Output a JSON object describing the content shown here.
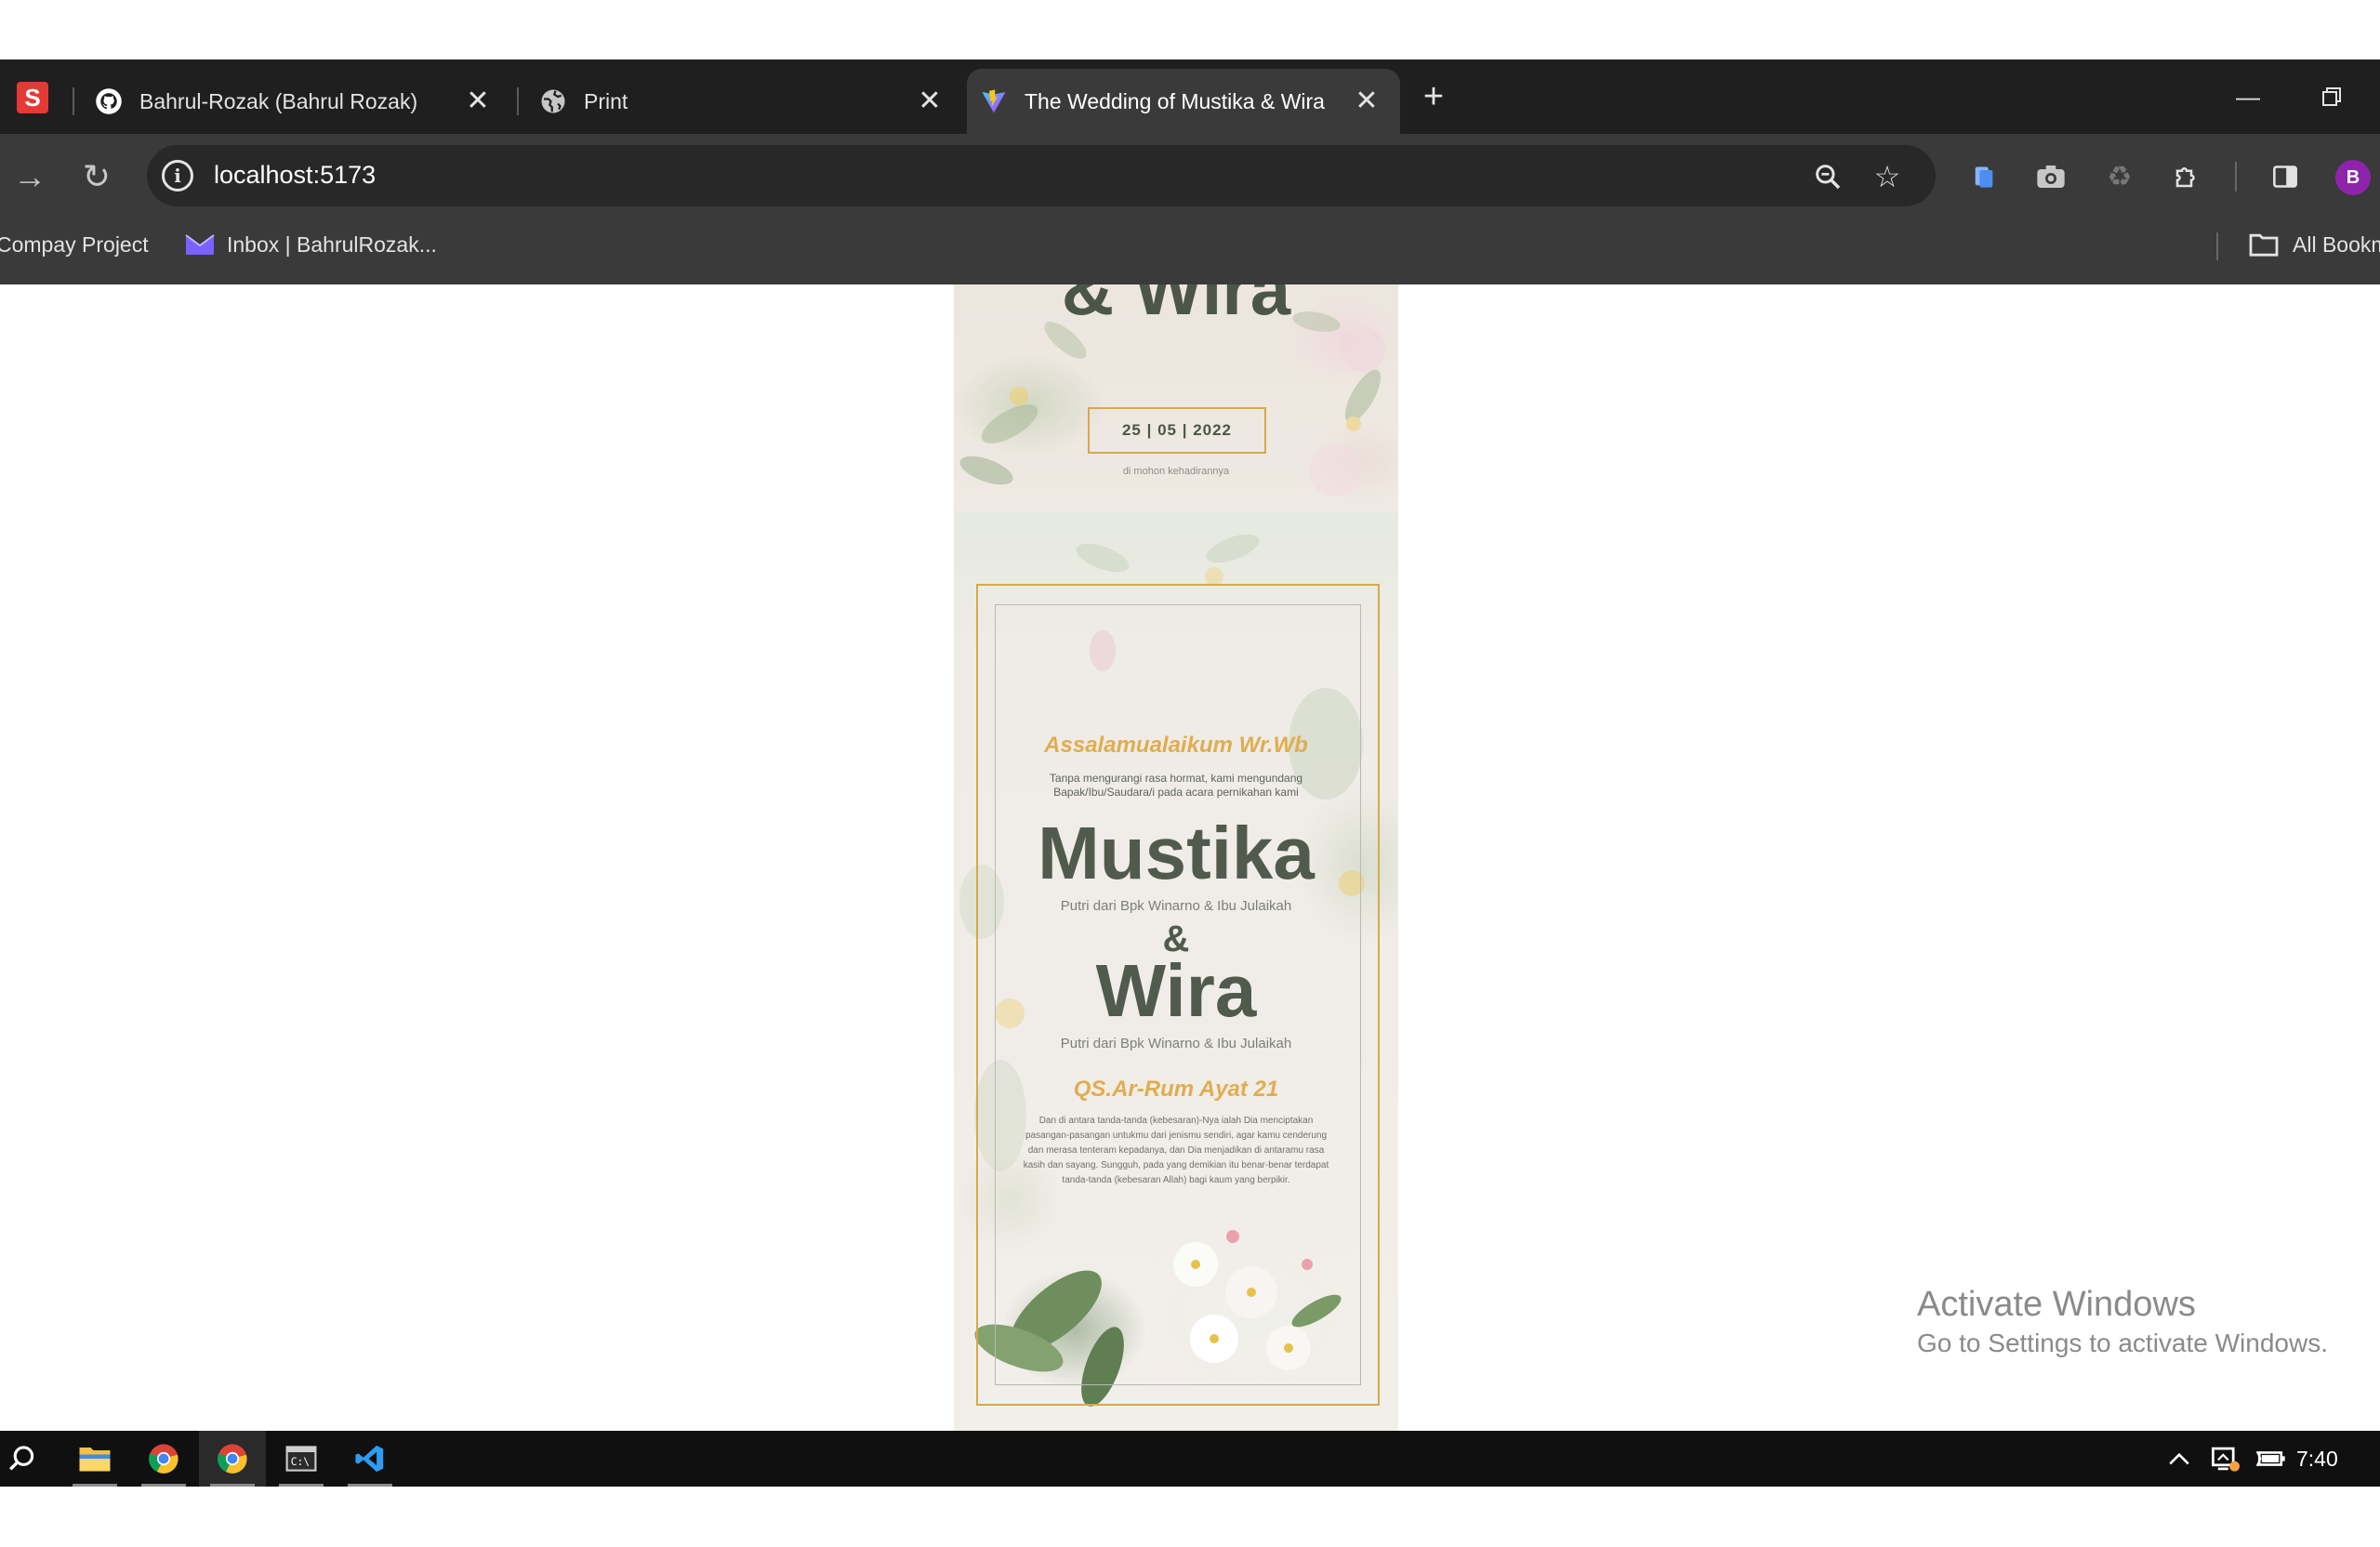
{
  "browser": {
    "tabs": [
      {
        "title": "Bahrul-Rozak (Bahrul Rozak)",
        "icon": "github-icon"
      },
      {
        "title": "Print",
        "icon": "globe-icon"
      },
      {
        "title": "The Wedding of Mustika & Wira",
        "icon": "vite-icon",
        "active": true
      }
    ],
    "pinned_icon": "S",
    "address": "localhost:5173",
    "profile_initial": "B",
    "bookmarks": [
      {
        "label": "Compay Project"
      },
      {
        "label": "Inbox | BahrulRozak..."
      }
    ],
    "all_bookmarks_label": "All Bookmarks"
  },
  "invitation": {
    "hero_name": "& Wira",
    "date": "25 | 05 | 2022",
    "hero_subtitle": "di mohon kehadirannya",
    "greeting": "Assalamualaikum Wr.Wb",
    "intro": "Tanpa mengurangi rasa hormat, kami mengundang Bapak/Ibu/Saudara/i pada acara pernikahan kami",
    "bride_name": "Mustika",
    "bride_parents": "Putri dari Bpk Winarno & Ibu Julaikah",
    "ampersand": "&",
    "groom_name": "Wira",
    "groom_parents": "Putri dari Bpk Winarno & Ibu Julaikah",
    "verse_title": "QS.Ar-Rum Ayat 21",
    "verse_text": "Dan di antara tanda-tanda (kebesaran)-Nya ialah Dia menciptakan pasangan-pasangan untukmu dari jenismu sendiri, agar kamu cenderung dan merasa tenteram kepadanya, dan Dia menjadikan di antaramu rasa kasih dan sayang. Sungguh, pada yang demikian itu benar-benar terdapat tanda-tanda (kebesaran Allah) bagi kaum yang berpikir.",
    "colors": {
      "gold": "#d6a94a",
      "accent_text": "#e0ad4f",
      "name_text": "#505b4d"
    }
  },
  "watermark": {
    "line1": "Activate Windows",
    "line2": "Go to Settings to activate Windows."
  },
  "taskbar": {
    "apps": [
      "search-icon",
      "file-explorer-icon",
      "chrome-icon",
      "chrome-icon",
      "terminal-icon",
      "vscode-icon"
    ],
    "time": "7:40"
  }
}
